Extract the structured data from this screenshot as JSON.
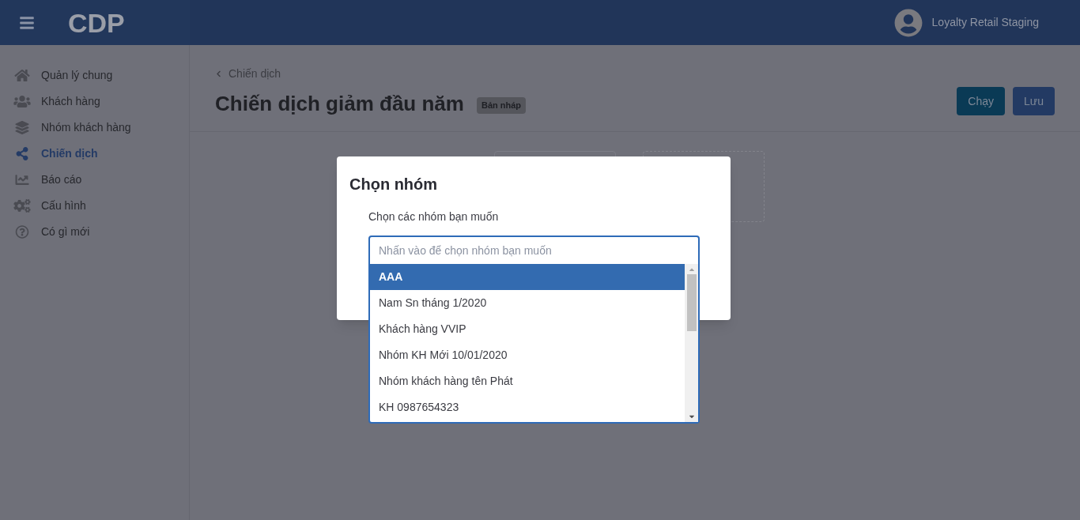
{
  "header": {
    "logo": "CDP",
    "account": "Loyalty Retail Staging"
  },
  "sidebar": {
    "items": [
      {
        "label": "Quản lý chung",
        "kind": "home",
        "selected": false
      },
      {
        "label": "Khách hàng",
        "kind": "users",
        "selected": false
      },
      {
        "label": "Nhóm khách hàng",
        "kind": "layers",
        "selected": false
      },
      {
        "label": "Chiến dịch",
        "kind": "share",
        "selected": true
      },
      {
        "label": "Báo cáo",
        "kind": "chart",
        "selected": false
      },
      {
        "label": "Cấu hình",
        "kind": "gears",
        "selected": false
      },
      {
        "label": "Có gì mới",
        "kind": "help",
        "selected": false
      }
    ]
  },
  "page": {
    "breadcrumb": "Chiến dịch",
    "title": "Chiến dịch giảm đầu năm",
    "status": "Bản nháp",
    "buttons": [
      {
        "label": "Chạy",
        "kind": "run"
      },
      {
        "label": "Lưu",
        "kind": "save"
      }
    ]
  },
  "dialog": {
    "title": "Chọn nhóm",
    "label": "Chọn các nhóm bạn muốn",
    "placeholder": "Nhấn vào để chọn nhóm bạn muốn",
    "options": [
      {
        "label": "AAA",
        "selected": true
      },
      {
        "label": "Nam Sn tháng 1/2020",
        "selected": false
      },
      {
        "label": "Khách hàng VVIP",
        "selected": false
      },
      {
        "label": "Nhóm KH Mới 10/01/2020",
        "selected": false
      },
      {
        "label": "Nhóm khách hàng tên Phát",
        "selected": false
      },
      {
        "label": "KH 0987654323",
        "selected": false
      }
    ]
  }
}
